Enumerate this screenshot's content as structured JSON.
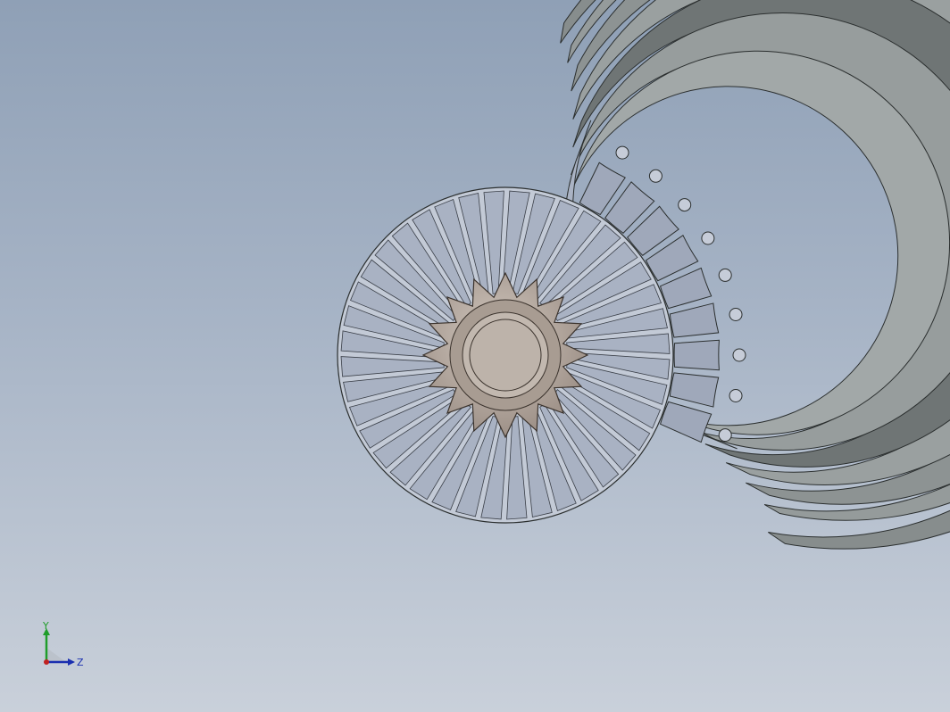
{
  "viewport": {
    "background_top": "#8fa0b6",
    "background_bottom": "#c9d0da"
  },
  "model": {
    "housing_color": "#8f9595",
    "housing_edge": "#2b2f2f",
    "blade_color": "#a9b2c3",
    "gear_color": "#b7aba1"
  },
  "triad": {
    "y_label": "Y",
    "z_label": "Z",
    "y_color": "#1f9d2a",
    "z_color": "#1a2fb0",
    "origin_color": "#c02020"
  }
}
